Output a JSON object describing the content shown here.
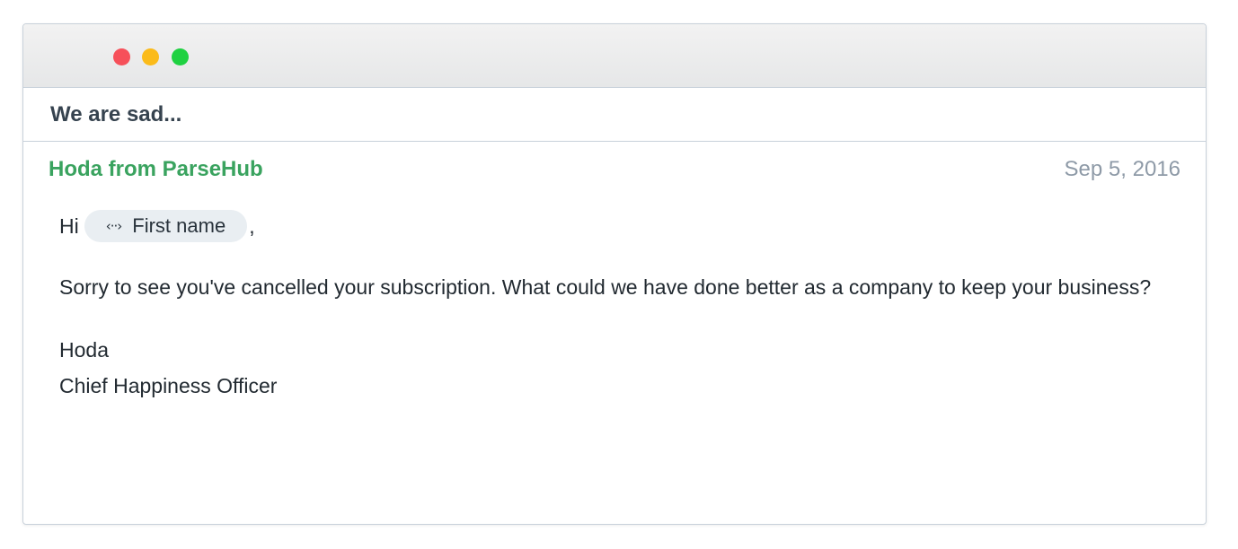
{
  "window": {
    "controls": {
      "close_color": "#f6505a",
      "minimize_color": "#fbbb1a",
      "maximize_color": "#1fd141"
    }
  },
  "email": {
    "subject": "We are sad...",
    "sender": "Hoda from ParseHub",
    "date": "Sep 5, 2016",
    "greeting_prefix": "Hi",
    "merge_tag": {
      "icon": "code-arrows-icon",
      "icon_glyph": "‹··›",
      "label": "First name"
    },
    "greeting_suffix": ",",
    "body_paragraph": "Sorry to see you've cancelled your subscription. What could we have done better as a company to keep your business?",
    "signature_name": "Hoda",
    "signature_title": "Chief Happiness Officer"
  },
  "colors": {
    "sender": "#3aa35f",
    "date": "#8e9aa7",
    "subject": "#36434f"
  }
}
